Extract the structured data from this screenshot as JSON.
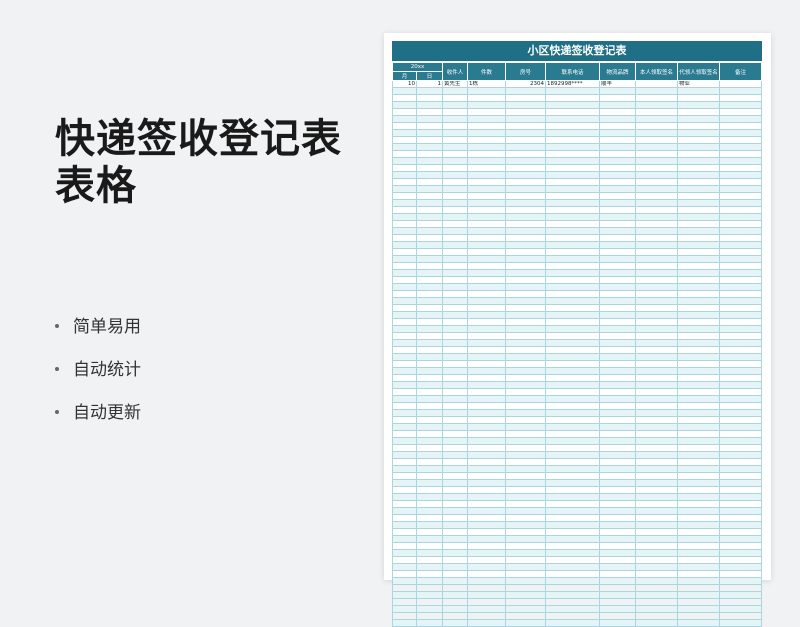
{
  "promo": {
    "title_line1": "快递签收登记表",
    "title_line2": "表格",
    "features": [
      "简单易用",
      "自动统计",
      "自动更新"
    ]
  },
  "sheet": {
    "title": "小区快递签收登记表",
    "year_header": "20xx",
    "month_header": "月",
    "day_header": "日",
    "columns": [
      "收件人",
      "件数",
      "房号",
      "联系电话",
      "物流品牌",
      "本人领取签名",
      "代领人领取签名",
      "备注"
    ],
    "data_rows": [
      [
        "10",
        "1",
        "黄先生",
        "1栋",
        "2304",
        "1892998****",
        "顺丰",
        "",
        "物业",
        ""
      ]
    ],
    "blank_row_count": 77
  },
  "colors": {
    "header_bg": "#2a7a90",
    "title_bg": "#1f6f86",
    "grid_line": "#a9d6df",
    "alt_row": "#e4f4f7",
    "page_bg": "#f0f2f3"
  }
}
